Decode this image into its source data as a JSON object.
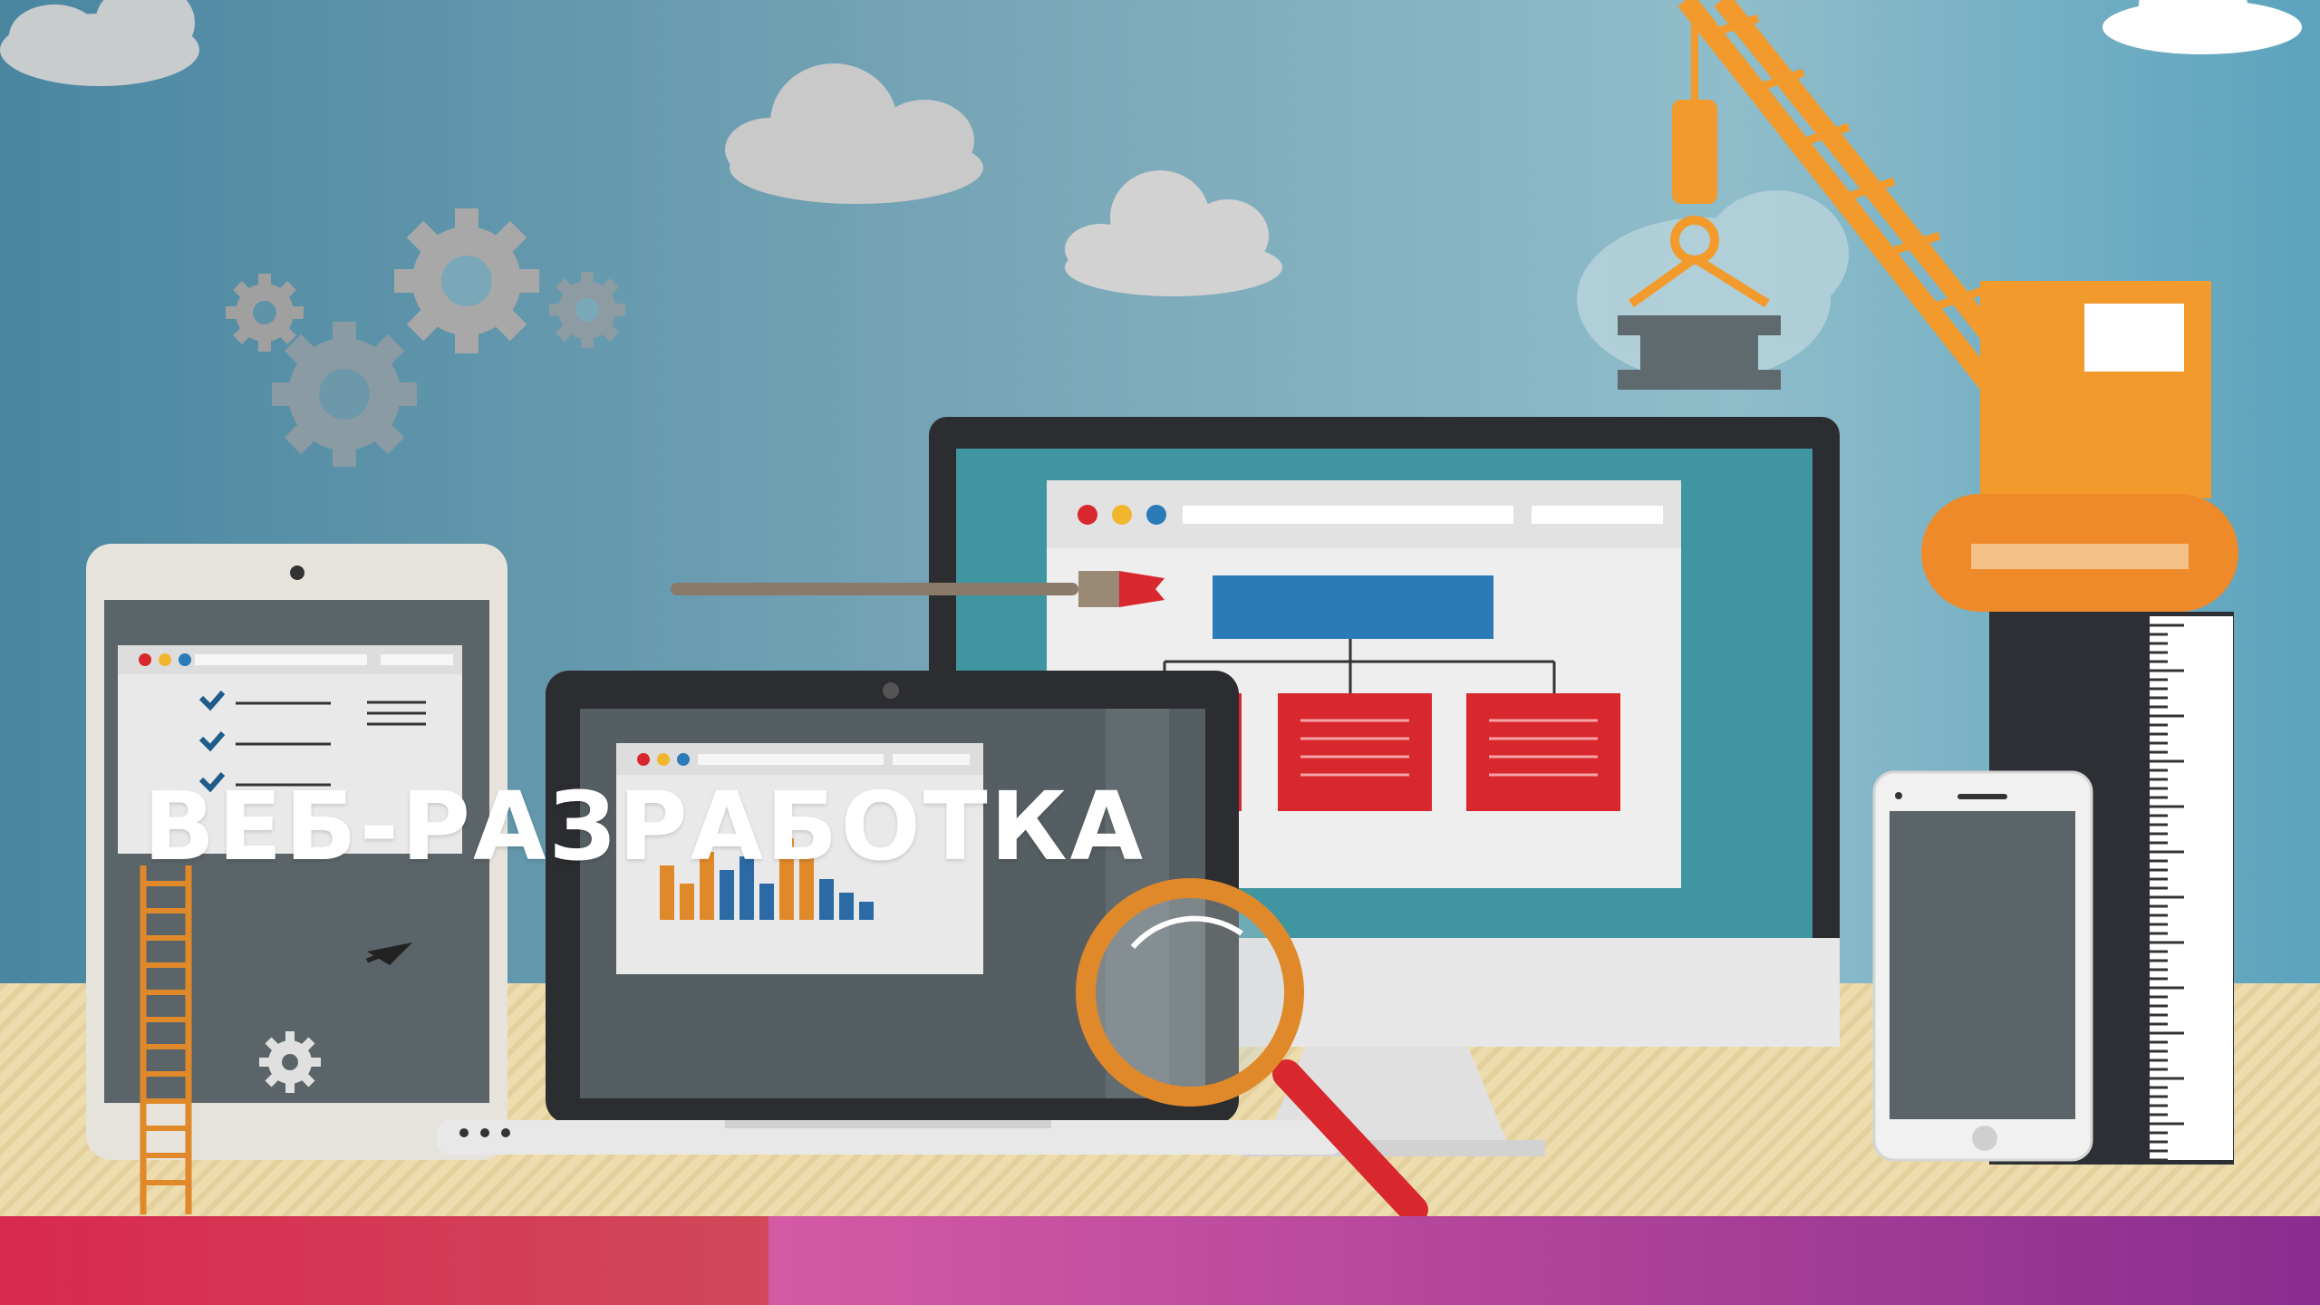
{
  "banner": {
    "title": "ВЕБ-РАЗРАБОТКА"
  },
  "illustration": {
    "elements": [
      "cloud",
      "gear-icon",
      "crane",
      "desktop-monitor",
      "laptop",
      "tablet",
      "smartphone",
      "magnifying-glass-icon",
      "paintbrush-icon",
      "ladder",
      "ruler",
      "bar-chart",
      "checklist",
      "site-map-diagram"
    ]
  },
  "colors": {
    "sky": "#5b9ab1",
    "floor": "#e8d9a8",
    "crane_orange": "#f39a2c",
    "monitor_screen": "#3f96a1",
    "sitemap_blue": "#2b7bb9",
    "sitemap_red": "#d9272e",
    "accent_left": "#d8294f",
    "accent_mid": "#d45aa4",
    "accent_right": "#8b2d8f"
  }
}
